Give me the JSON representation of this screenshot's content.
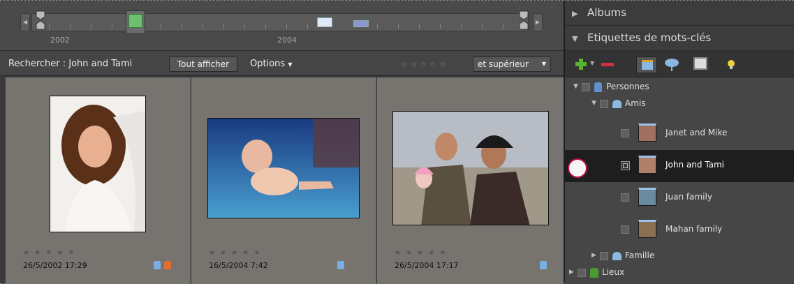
{
  "timeline": {
    "years": [
      "2002",
      "2004"
    ]
  },
  "search": {
    "label": "Rechercher : John and Tami",
    "show_all": "Tout afficher",
    "options": "Options",
    "rating_filter": "et supérieur"
  },
  "photos": [
    {
      "date": "26/5/2002 17:29",
      "stars": "★ ★ ★ ★ ★"
    },
    {
      "date": "16/5/2004 7:42",
      "stars": "★ ★ ★ ★ ★"
    },
    {
      "date": "26/5/2004 17:17",
      "stars": "★ ★ ★ ★ ★"
    }
  ],
  "panel": {
    "albums": "Albums",
    "keyword_tags": "Etiquettes de mots-clés"
  },
  "tree": {
    "people": "Personnes",
    "friends": "Amis",
    "items": [
      {
        "label": "Janet and Mike"
      },
      {
        "label": "John and Tami"
      },
      {
        "label": "Juan family"
      },
      {
        "label": "Mahan family"
      }
    ],
    "family": "Famille",
    "places": "Lieux"
  },
  "colors": {
    "accent_selection": "#1e1e1e",
    "tag_blue": "#7ab0e0",
    "lock_orange": "#e07030",
    "add_green": "#5ab030",
    "remove_red": "#d03040",
    "callout_ring": "#c0104a"
  }
}
